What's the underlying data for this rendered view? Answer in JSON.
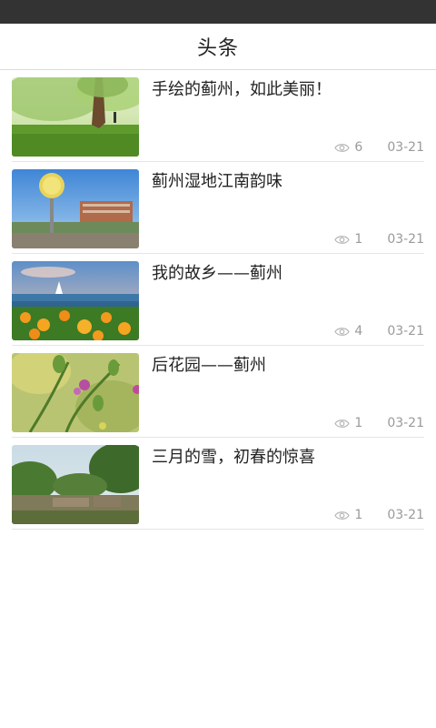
{
  "header": {
    "title": "头条"
  },
  "articles": [
    {
      "title": "手绘的蓟州，如此美丽！",
      "views": "6",
      "date": "03-21"
    },
    {
      "title": "蓟州湿地江南韵味",
      "views": "1",
      "date": "03-21"
    },
    {
      "title": "我的故乡——蓟州",
      "views": "4",
      "date": "03-21"
    },
    {
      "title": "后花园——蓟州",
      "views": "1",
      "date": "03-21"
    },
    {
      "title": "三月的雪，初春的惊喜",
      "views": "1",
      "date": "03-21"
    }
  ],
  "icons": {
    "views": "eye-icon"
  }
}
